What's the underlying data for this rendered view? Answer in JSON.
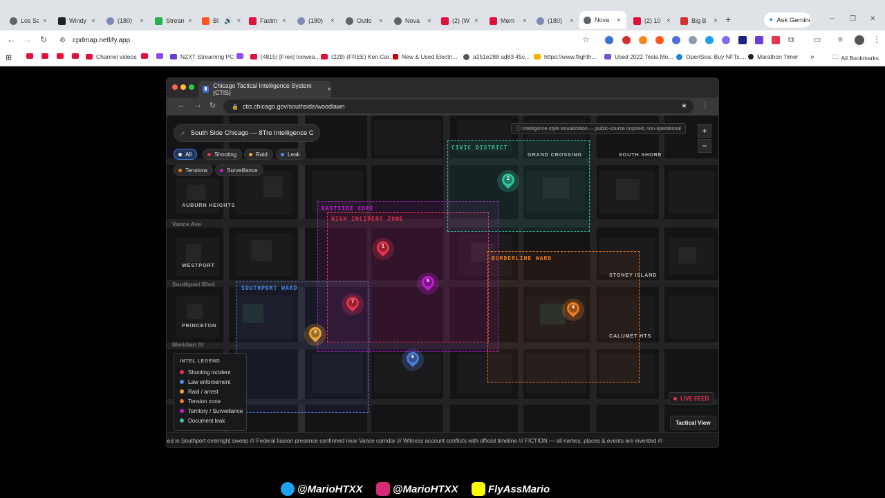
{
  "outer_browser": {
    "tabs": [
      {
        "label": "Los Sa",
        "color": "#5f6368"
      },
      {
        "label": "Windy",
        "color": "#222222"
      },
      {
        "label": "(180)",
        "color": "#7a8bb5"
      },
      {
        "label": "Stream",
        "color": "#22b24c"
      },
      {
        "label": "Bl",
        "color": "#ff5722"
      },
      {
        "label": "Fastm",
        "color": "#e0103a"
      },
      {
        "label": "(180)",
        "color": "#7a8bb5"
      },
      {
        "label": "Outlo",
        "color": "#5f6368"
      },
      {
        "label": "Nova",
        "color": "#5f6368"
      },
      {
        "label": "(2) (W",
        "color": "#e0103a"
      },
      {
        "label": "Mem",
        "color": "#e0103a"
      },
      {
        "label": "(180)",
        "color": "#7a8bb5"
      },
      {
        "label": "Nova",
        "color": "#5f6368",
        "active": true
      },
      {
        "label": "(2) 10",
        "color": "#e0103a"
      },
      {
        "label": "Big B",
        "color": "#d32f2f"
      }
    ],
    "ask_gemini": "Ask Gemini",
    "url": "cpdmap.netlify.app",
    "bookmarks": [
      "Channel videos",
      "NZXT Streaming PC",
      "(4815) [Free] Icewea...",
      "(229) (FREE) Ken Car...",
      "New & Used Electri...",
      "a251e288 ad83 45c...",
      "https://www.flighth...",
      "Used 2022 Tesla Mo...",
      "OpenSea: Buy NFTs,...",
      "Marathon Timer"
    ],
    "all_bookmarks": "All Bookmarks"
  },
  "inner_browser": {
    "tab_title": "Chicago Tactical Intelligence System (CTIS)",
    "url": "ctis.chicago.gov/southside/woodlawn"
  },
  "map": {
    "search_value": "South Side Chicago — 8Tre Intelligence C",
    "filters": [
      {
        "label": "All",
        "color": "#ffffff",
        "active": true
      },
      {
        "label": "Shooting",
        "color": "#e8344c"
      },
      {
        "label": "Raid",
        "color": "#f0a53a"
      },
      {
        "label": "Leak",
        "color": "#4c8df0"
      },
      {
        "label": "Tensions",
        "color": "#f07a1f"
      },
      {
        "label": "Surveillance",
        "color": "#c21cd6"
      }
    ],
    "disclaimer": "ⓘ Intelligence-style visualization — public-source inspired, non-operational",
    "zoom_in": "+",
    "zoom_out": "−",
    "zones": {
      "civic": "CIVIC DISTRICT",
      "eastside": "EASTSIDE CORE",
      "high_incident": "HIGH INCIDENT ZONE",
      "borderline": "BORDERLINE WARD",
      "southport": "SOUTHPORT WARD"
    },
    "area_labels": {
      "grand_crossing": "GRAND CROSSING",
      "south_shore": "SOUTH SHORE",
      "auburn_heights": "AUBURN HEIGHTS",
      "westport": "WESTPORT",
      "stoney_island": "STONEY ISLAND",
      "princeton": "PRINCETON",
      "calumet_hts": "CALUMET HTS"
    },
    "streets": {
      "vance": "Vance Ave",
      "southport": "Southport Blvd",
      "meridian": "Meridian St"
    },
    "pins": [
      {
        "num": "1",
        "color": "#e8344c"
      },
      {
        "num": "2",
        "color": "#2ec4a0"
      },
      {
        "num": "3",
        "color": "#f0a53a"
      },
      {
        "num": "4",
        "color": "#f07a1f"
      },
      {
        "num": "5",
        "color": "#c21cd6"
      },
      {
        "num": "6",
        "color": "#4c7bd9"
      },
      {
        "num": "7",
        "color": "#e8344c"
      }
    ],
    "legend": {
      "title": "INTEL LEGEND",
      "items": [
        {
          "label": "Shooting incident",
          "color": "#e8344c"
        },
        {
          "label": "Law enforcement",
          "color": "#4c8df0"
        },
        {
          "label": "Raid / arrest",
          "color": "#f0a53a"
        },
        {
          "label": "Tension zone",
          "color": "#f07a1f"
        },
        {
          "label": "Territory / Surveillance",
          "color": "#c21cd6"
        },
        {
          "label": "Document leak",
          "color": "#2ec4a0"
        }
      ]
    },
    "live_feed": "LIVE FEED",
    "tactical_view": "Tactical View",
    "ticker": "ained in Southport overnight sweep  ///  Federal liaison presence confirmed near Vance corridor  ///  Witness account conflicts with official timeline  ///  FICTION — all names, places & events are invented  ///"
  },
  "social": {
    "twitter": "@MarioHTXX",
    "instagram": "@MarioHTXX",
    "snapchat": "FlyAssMario"
  }
}
